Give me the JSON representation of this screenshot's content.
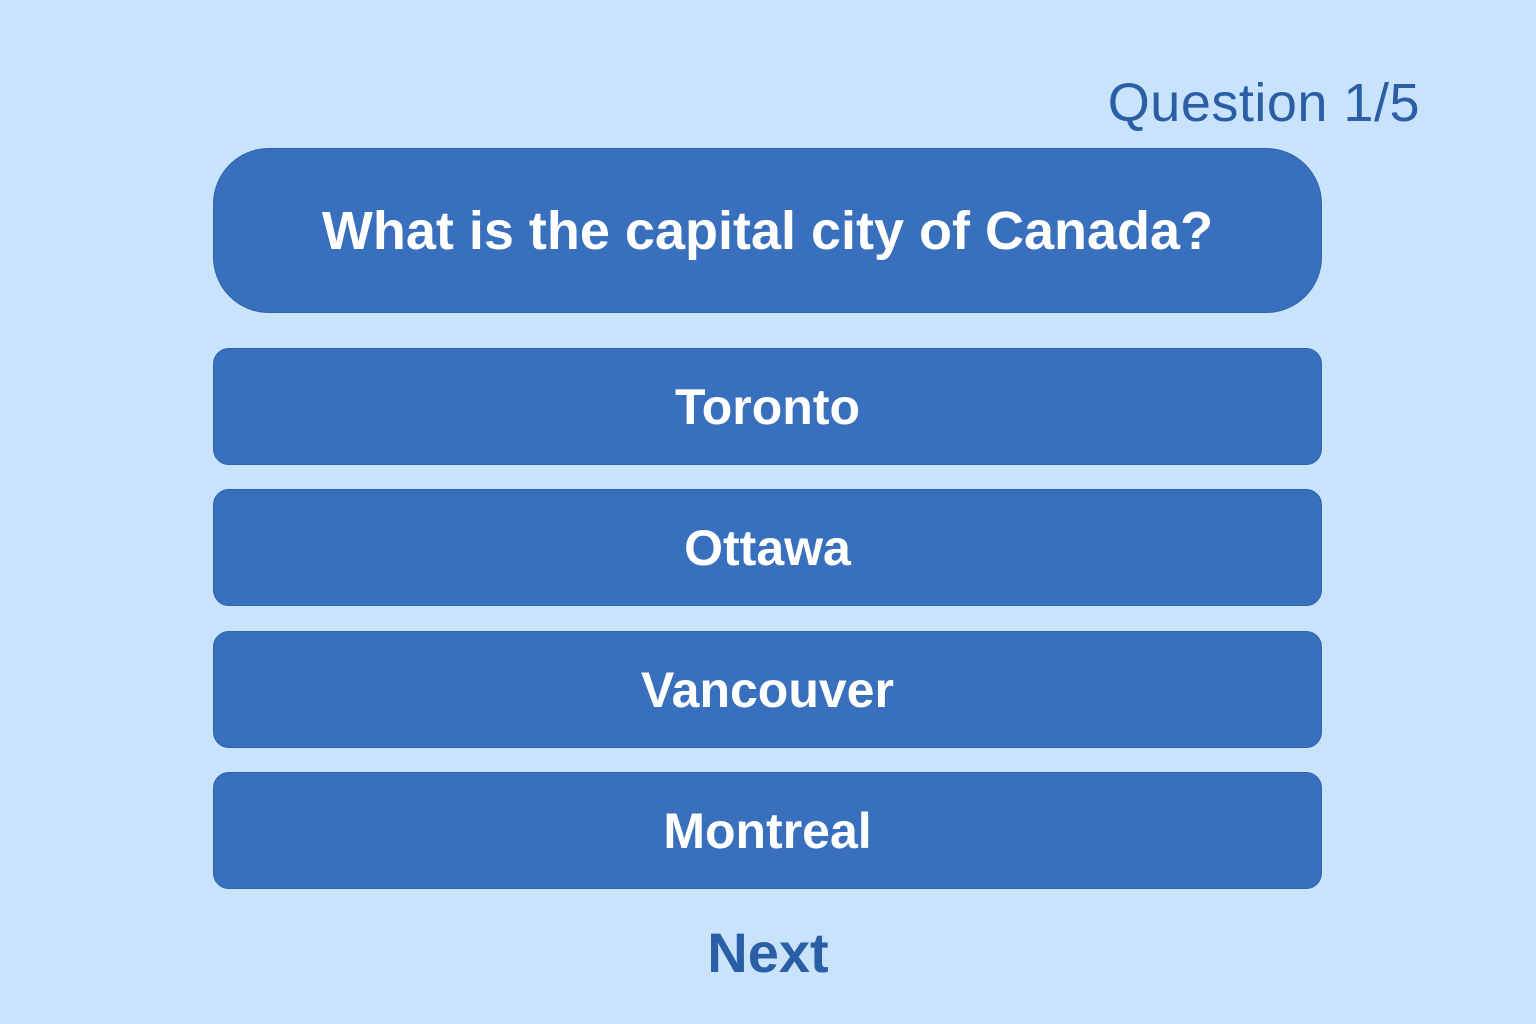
{
  "header": {
    "progress_text": "Question 1/5"
  },
  "question": {
    "text": "What is the capital city of Canada?"
  },
  "options": [
    {
      "label": "Toronto"
    },
    {
      "label": "Ottawa"
    },
    {
      "label": "Vancouver"
    },
    {
      "label": "Montreal"
    }
  ],
  "footer": {
    "next_label": "Next"
  },
  "colors": {
    "background": "#c8e3fb",
    "card": "#3870bd",
    "accent_text": "#2a5ea5",
    "card_text": "#ffffff"
  }
}
